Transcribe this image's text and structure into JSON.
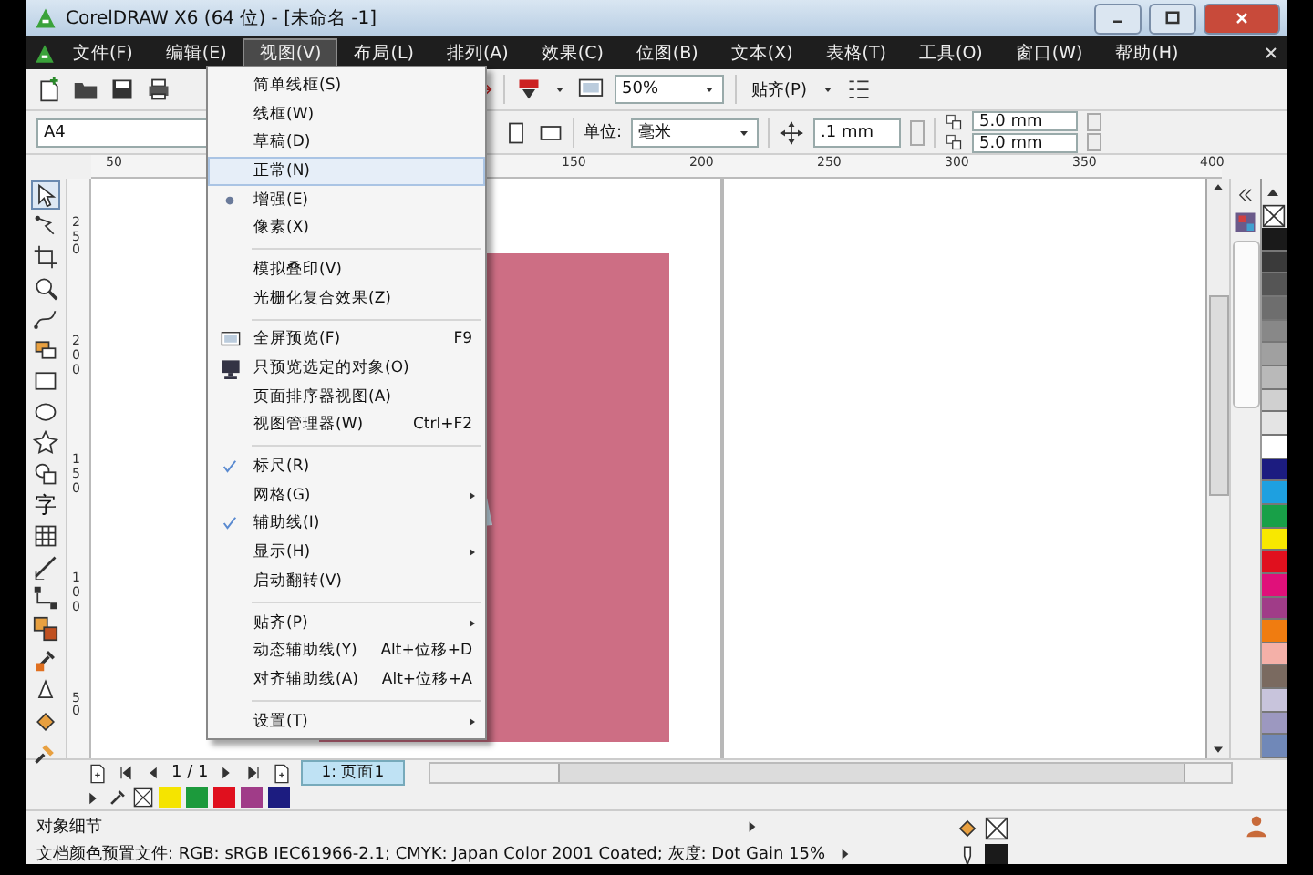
{
  "window": {
    "title": "CorelDRAW X6 (64 位) - [未命名 -1]"
  },
  "menubar": [
    {
      "label": "文件(F)",
      "selected": false
    },
    {
      "label": "编辑(E)",
      "selected": false
    },
    {
      "label": "视图(V)",
      "selected": true
    },
    {
      "label": "布局(L)",
      "selected": false
    },
    {
      "label": "排列(A)",
      "selected": false
    },
    {
      "label": "效果(C)",
      "selected": false
    },
    {
      "label": "位图(B)",
      "selected": false
    },
    {
      "label": "文本(X)",
      "selected": false
    },
    {
      "label": "表格(T)",
      "selected": false
    },
    {
      "label": "工具(O)",
      "selected": false
    },
    {
      "label": "窗口(W)",
      "selected": false
    },
    {
      "label": "帮助(H)",
      "selected": false
    }
  ],
  "toolbar": {
    "zoom": "50%",
    "snap": "贴齐(P)"
  },
  "property_bar": {
    "page_size": "A4",
    "unit_label": "单位:",
    "unit": "毫米",
    "nudge": ".1 mm",
    "duplicate_x": "5.0 mm",
    "duplicate_y": "5.0 mm"
  },
  "toolbox": {
    "text_tool": "字"
  },
  "rulers": {
    "horizontal": [
      "50",
      "150",
      "200",
      "250",
      "300",
      "350",
      "400"
    ],
    "vertical": [
      "250",
      "200",
      "150",
      "100",
      "50"
    ]
  },
  "view_menu": [
    [
      {
        "label": "简单线框(S)",
        "kind": "plain",
        "selected": false,
        "submenu": false
      },
      {
        "label": "线框(W)",
        "kind": "plain",
        "selected": false,
        "submenu": false
      },
      {
        "label": "草稿(D)",
        "kind": "plain",
        "selected": false,
        "submenu": false
      },
      {
        "label": "正常(N)",
        "kind": "plain",
        "selected": true,
        "submenu": false
      },
      {
        "label": "增强(E)",
        "kind": "radio",
        "checked": true,
        "selected": false,
        "submenu": false
      },
      {
        "label": "像素(X)",
        "kind": "plain",
        "selected": false,
        "submenu": false
      }
    ],
    [
      {
        "label": "模拟叠印(V)",
        "kind": "plain",
        "selected": false,
        "submenu": false
      },
      {
        "label": "光栅化复合效果(Z)",
        "kind": "plain",
        "selected": false,
        "submenu": false
      }
    ],
    [
      {
        "label": "全屏预览(F)",
        "kind": "icon",
        "shortcut": "F9",
        "selected": false,
        "submenu": false
      },
      {
        "label": "只预览选定的对象(O)",
        "kind": "icon",
        "selected": false,
        "submenu": false
      },
      {
        "label": "页面排序器视图(A)",
        "kind": "plain",
        "selected": false,
        "submenu": false
      },
      {
        "label": "视图管理器(W)",
        "kind": "plain",
        "shortcut": "Ctrl+F2",
        "selected": false,
        "submenu": false
      }
    ],
    [
      {
        "label": "标尺(R)",
        "kind": "check",
        "checked": true,
        "selected": false,
        "submenu": false
      },
      {
        "label": "网格(G)",
        "kind": "plain",
        "selected": false,
        "submenu": true
      },
      {
        "label": "辅助线(I)",
        "kind": "check",
        "checked": true,
        "selected": false,
        "submenu": false
      },
      {
        "label": "显示(H)",
        "kind": "plain",
        "selected": false,
        "submenu": true
      },
      {
        "label": "启动翻转(V)",
        "kind": "plain",
        "selected": false,
        "submenu": false
      }
    ],
    [
      {
        "label": "贴齐(P)",
        "kind": "plain",
        "selected": false,
        "submenu": true
      },
      {
        "label": "动态辅助线(Y)",
        "kind": "plain",
        "shortcut": "Alt+位移+D",
        "selected": false,
        "submenu": false
      },
      {
        "label": "对齐辅助线(A)",
        "kind": "plain",
        "shortcut": "Alt+位移+A",
        "selected": false,
        "submenu": false
      }
    ],
    [
      {
        "label": "设置(T)",
        "kind": "plain",
        "selected": false,
        "submenu": true
      }
    ]
  ],
  "page_nav": {
    "counter": "1 / 1",
    "page_tab": "1: 页面1"
  },
  "document_palette": [
    {
      "color": "#f5e400"
    },
    {
      "color": "#1c9a3c"
    },
    {
      "color": "#e0101e"
    },
    {
      "color": "#a03c88"
    },
    {
      "color": "#1c1c80"
    }
  ],
  "color_palette": [
    {
      "color": "#1a1a1a"
    },
    {
      "color": "#3a3a3a"
    },
    {
      "color": "#555555"
    },
    {
      "color": "#6e6e6e"
    },
    {
      "color": "#888888"
    },
    {
      "color": "#a0a0a0"
    },
    {
      "color": "#b9b9b9"
    },
    {
      "color": "#d0d0d0"
    },
    {
      "color": "#e4e4e4"
    },
    {
      "color": "#ffffff"
    },
    {
      "color": "#1c1c80"
    },
    {
      "color": "#1ea0e0"
    },
    {
      "color": "#18a048"
    },
    {
      "color": "#f8e800"
    },
    {
      "color": "#e0101e"
    },
    {
      "color": "#e0107a"
    },
    {
      "color": "#a03c88"
    },
    {
      "color": "#f07c10"
    },
    {
      "color": "#f4b0a8"
    },
    {
      "color": "#7a6a60"
    },
    {
      "color": "#c8c4dc"
    },
    {
      "color": "#9c98c0"
    },
    {
      "color": "#7088b8"
    }
  ],
  "status_bar": {
    "object_details": "对象细节",
    "color_profile": "文档颜色预置文件: RGB: sRGB IEC61966-2.1; CMYK: Japan Color 2001 Coated; 灰度: Dot Gain 15%"
  }
}
